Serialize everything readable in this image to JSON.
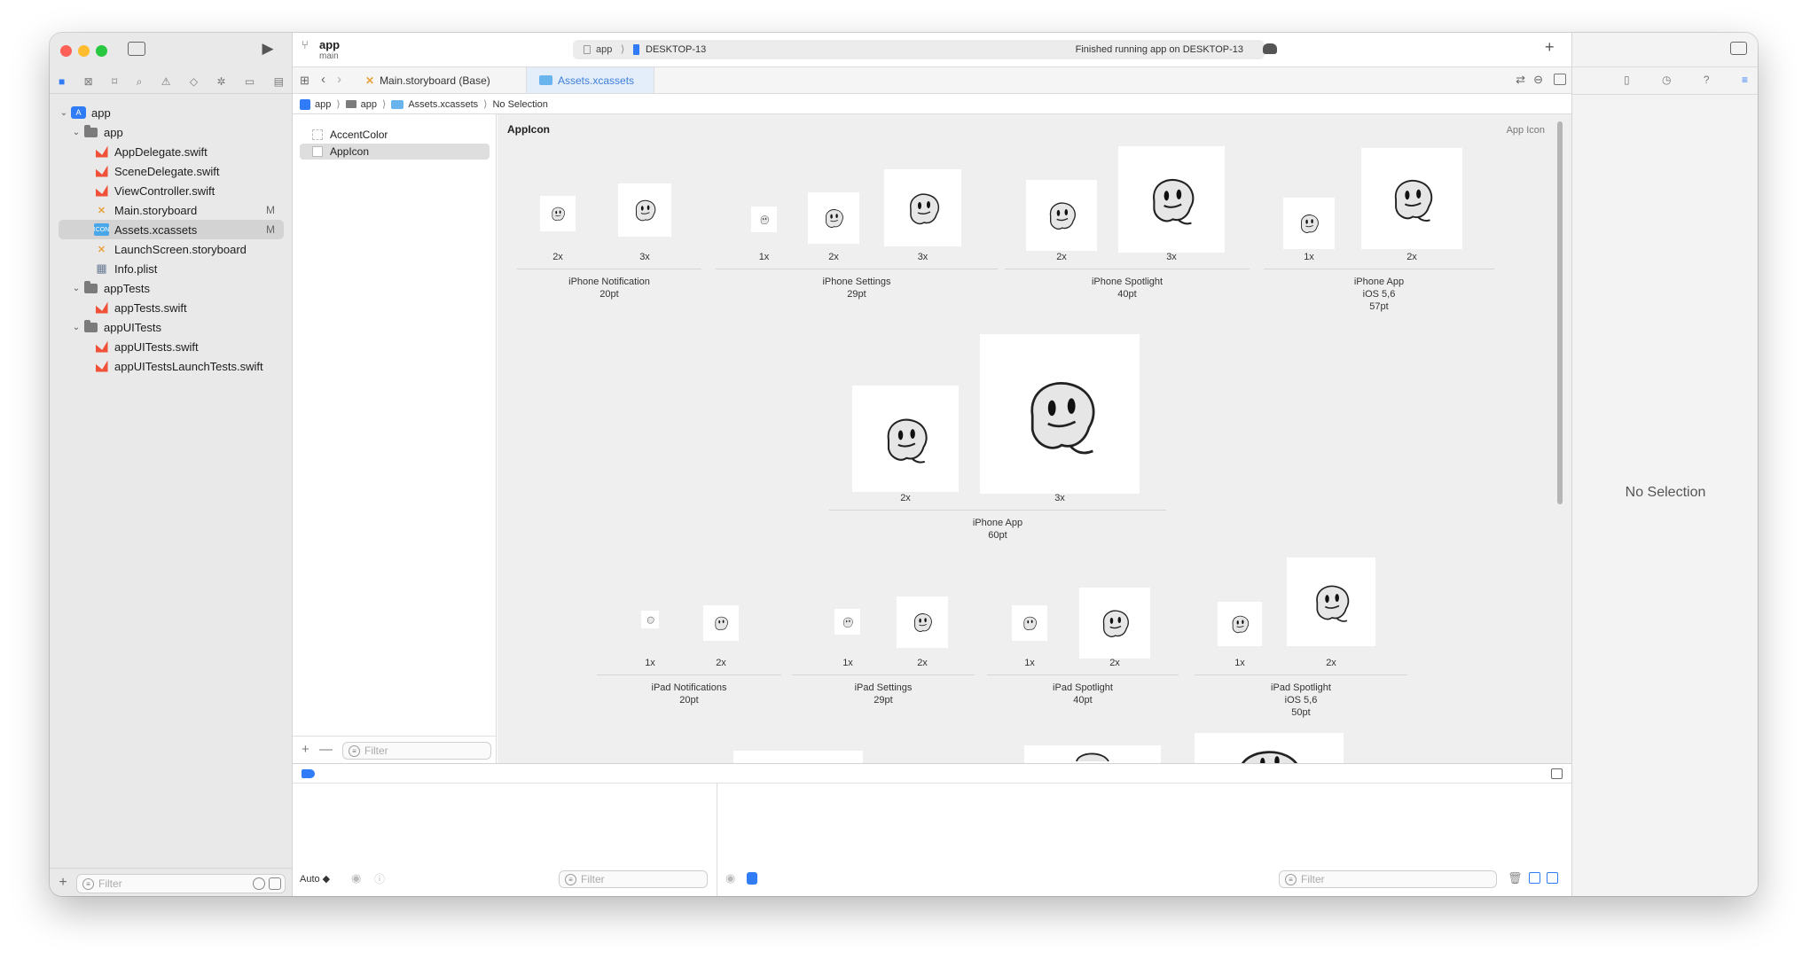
{
  "toolbar": {
    "scheme_name": "app",
    "scheme_branch": "main",
    "dest_app": "app",
    "dest_device": "DESKTOP-13",
    "status": "Finished running app on DESKTOP-13",
    "play_glyph": "▶",
    "add_glyph": "+"
  },
  "tabs": [
    {
      "label": "Main.storyboard (Base)"
    },
    {
      "label": "Assets.xcassets"
    }
  ],
  "breadcrumb": [
    "app",
    "app",
    "Assets.xcassets",
    "No Selection"
  ],
  "navigator": {
    "items": [
      {
        "label": "app",
        "badge": ""
      },
      {
        "label": "app",
        "badge": ""
      },
      {
        "label": "AppDelegate.swift",
        "badge": ""
      },
      {
        "label": "SceneDelegate.swift",
        "badge": ""
      },
      {
        "label": "ViewController.swift",
        "badge": ""
      },
      {
        "label": "Main.storyboard",
        "badge": "M"
      },
      {
        "label": "Assets.xcassets",
        "badge": "M"
      },
      {
        "label": "LaunchScreen.storyboard",
        "badge": ""
      },
      {
        "label": "Info.plist",
        "badge": ""
      },
      {
        "label": "appTests",
        "badge": ""
      },
      {
        "label": "appTests.swift",
        "badge": ""
      },
      {
        "label": "appUITests",
        "badge": ""
      },
      {
        "label": "appUITests.swift",
        "badge": ""
      },
      {
        "label": "appUITestsLaunchTests.swift",
        "badge": ""
      }
    ],
    "filter_placeholder": "Filter"
  },
  "assets": {
    "items": [
      "AccentColor",
      "AppIcon"
    ],
    "filter_placeholder": "Filter"
  },
  "editor": {
    "title": "AppIcon",
    "type_label": "App Icon",
    "groups": [
      {
        "name": "iPhone Notification",
        "size": "20pt",
        "scales": [
          "2x",
          "3x"
        ]
      },
      {
        "name": "iPhone Settings",
        "size": "29pt",
        "scales": [
          "1x",
          "2x",
          "3x"
        ]
      },
      {
        "name": "iPhone Spotlight",
        "size": "40pt",
        "scales": [
          "2x",
          "3x"
        ]
      },
      {
        "name": "iPhone App",
        "size": "iOS 5,6",
        "size2": "57pt",
        "scales": [
          "1x",
          "2x"
        ]
      },
      {
        "name": "iPhone App",
        "size": "60pt",
        "scales": [
          "2x",
          "3x"
        ]
      },
      {
        "name": "iPad Notifications",
        "size": "20pt",
        "scales": [
          "1x",
          "2x"
        ]
      },
      {
        "name": "iPad Settings",
        "size": "29pt",
        "scales": [
          "1x",
          "2x"
        ]
      },
      {
        "name": "iPad Spotlight",
        "size": "40pt",
        "scales": [
          "1x",
          "2x"
        ]
      },
      {
        "name": "iPad Spotlight",
        "size": "iOS 5,6",
        "size2": "50pt",
        "scales": [
          "1x",
          "2x"
        ]
      }
    ]
  },
  "debug": {
    "auto_label": "Auto ◆",
    "filter_left": "Filter",
    "filter_right": "Filter"
  },
  "inspector": {
    "empty": "No Selection"
  }
}
